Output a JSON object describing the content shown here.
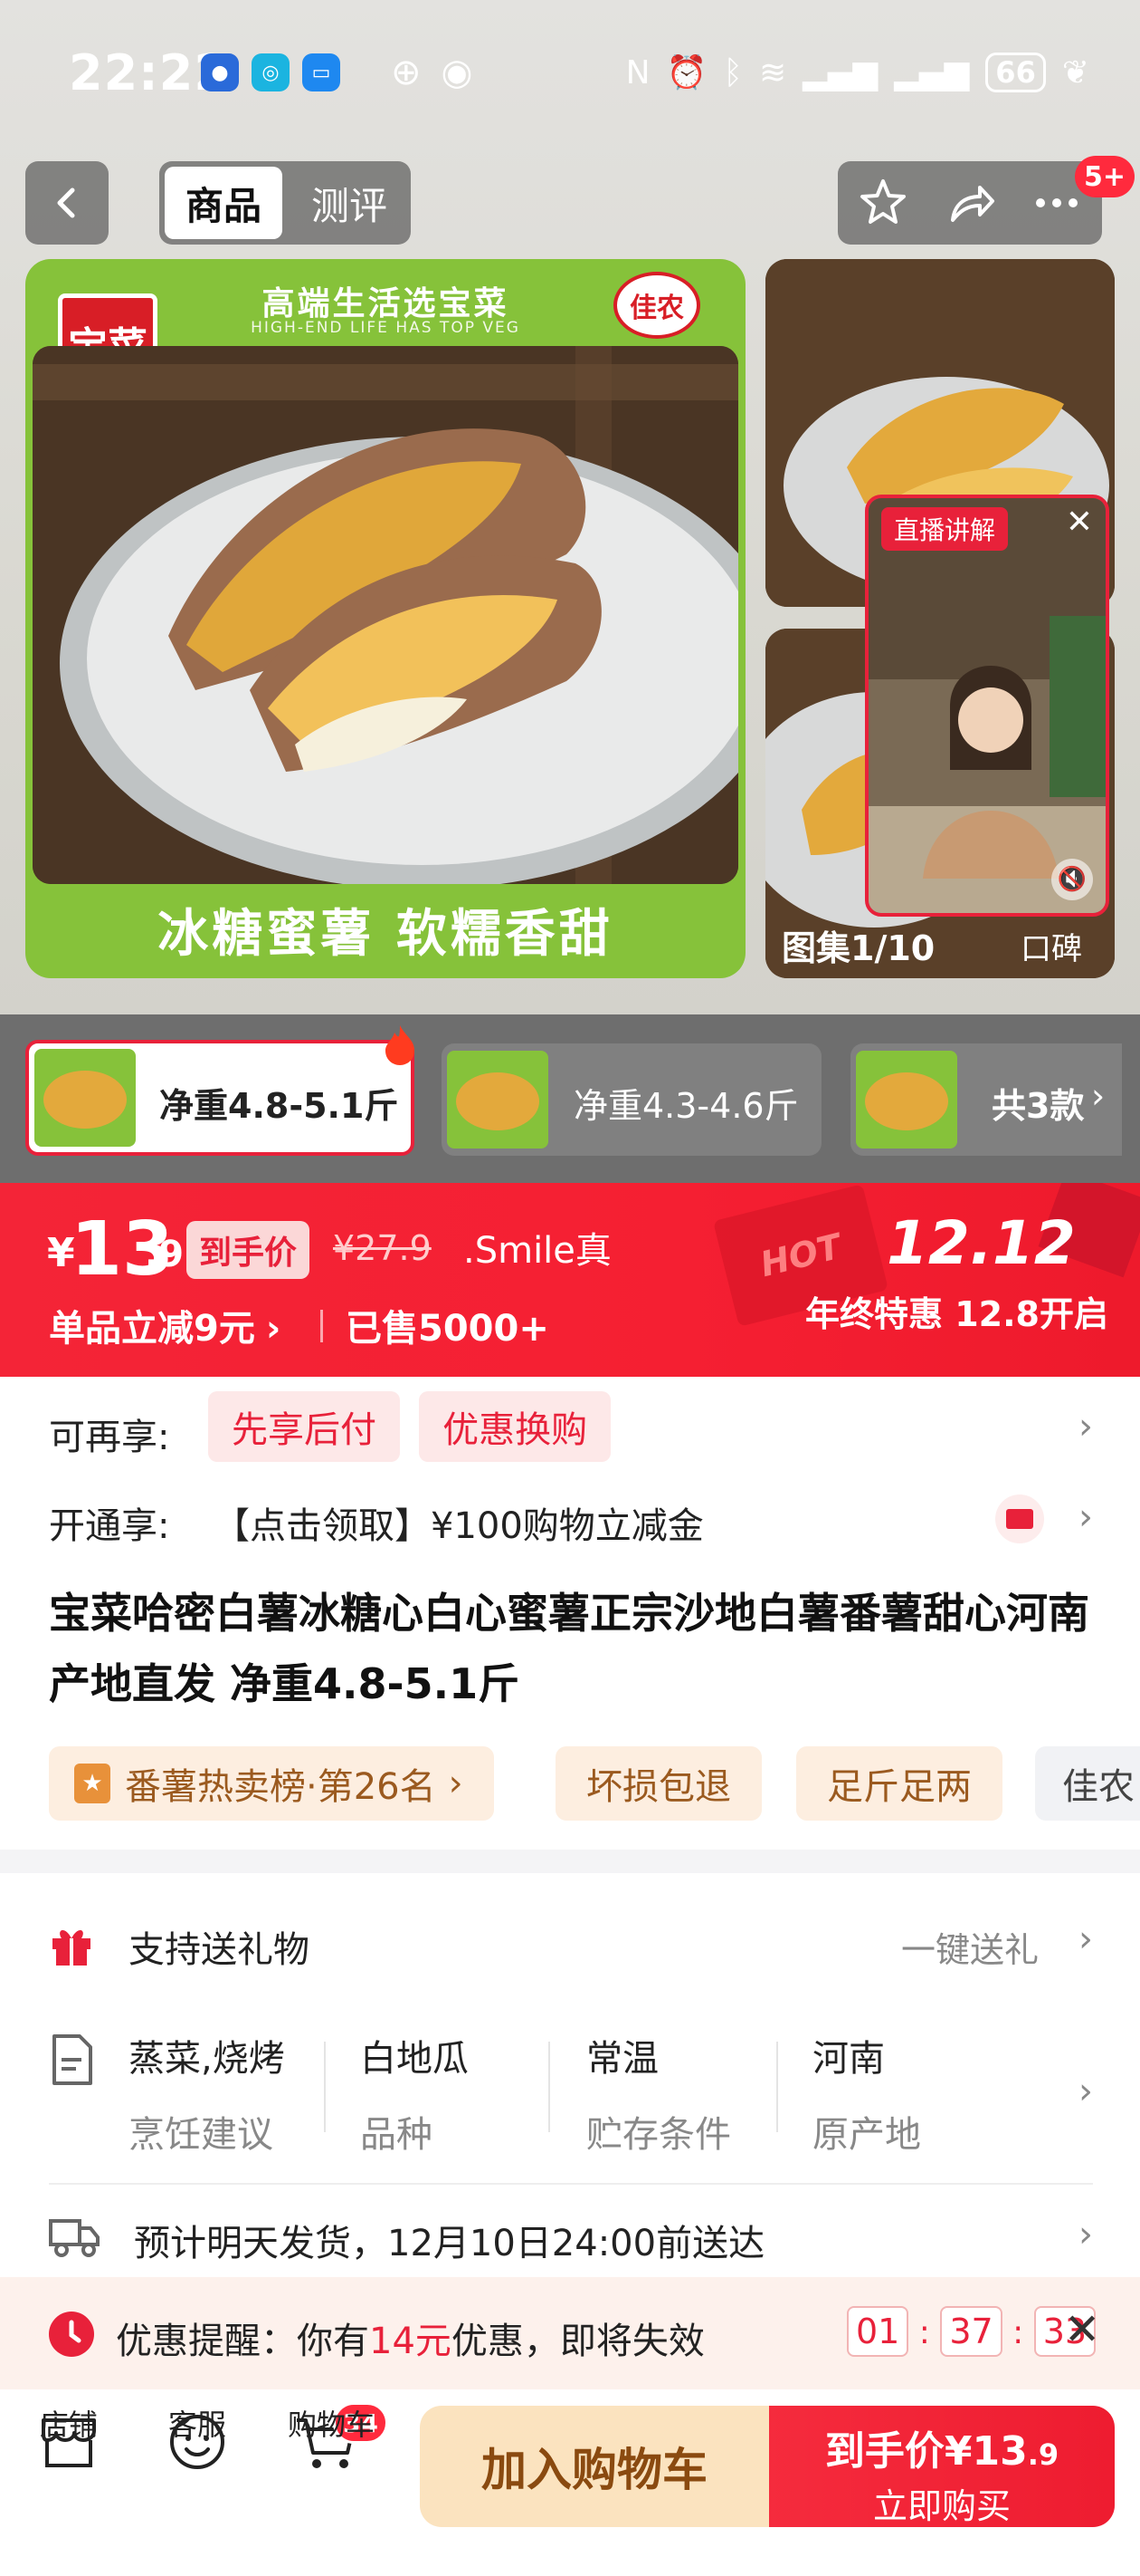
{
  "status_bar": {
    "time": "22:22",
    "battery": "66"
  },
  "nav": {
    "tab_product": "商品",
    "tab_review": "测评",
    "badge": "5+"
  },
  "hero": {
    "brand_logo": "宝菜",
    "slogan": "高端生活选宝菜",
    "slogan_en": "HIGH-END LIFE HAS TOP VEG",
    "partner_logo": "佳农",
    "caption": "冰糖蜜薯  软糯香甜"
  },
  "side_panel": {
    "live_label": "直播讲解",
    "gallery_counter": "图集1/10",
    "reviews_label": "口碑"
  },
  "variants": {
    "items": [
      {
        "label": "净重4.8-5.1斤"
      },
      {
        "label": "净重4.3-4.6斤"
      }
    ],
    "more": "共3款"
  },
  "price": {
    "currency": "¥",
    "integer": "13",
    "decimal": ".9",
    "final_badge": "到手价",
    "original": "¥27.9",
    "brand_note": ".Smile真",
    "discount": "单品立减9元",
    "sold": "已售5000+",
    "promo_date": "12.12",
    "promo_text": "年终特惠 12.8开启",
    "hot": "HOT"
  },
  "benefits": {
    "label1": "可再享:",
    "pill1": "先享后付",
    "pill2": "优惠换购",
    "label2": "开通享:",
    "offer": "【点击领取】¥100购物立减金"
  },
  "product": {
    "title": "宝菜哈密白薯冰糖心白心蜜薯正宗沙地白薯番薯甜心河南产地直发 净重4.8-5.1斤",
    "tags": [
      "番薯热卖榜·第26名",
      "坏损包退",
      "足斤足两",
      "佳农"
    ]
  },
  "gift": {
    "label": "支持送礼物",
    "action": "一键送礼"
  },
  "specs": [
    {
      "value": "蒸菜,烧烤",
      "key": "烹饪建议"
    },
    {
      "value": "白地瓜",
      "key": "品种"
    },
    {
      "value": "常温",
      "key": "贮存条件"
    },
    {
      "value": "河南",
      "key": "原产地"
    }
  ],
  "shipping": {
    "text": "预计明天发货，12月10日24:00前送达"
  },
  "reminder": {
    "prefix": "优惠提醒：你有",
    "amount": "14元",
    "suffix": "优惠，即将失效",
    "hh": "01",
    "mm": "37",
    "ss": "33"
  },
  "tabbar": {
    "store": "店铺",
    "service": "客服",
    "cart": "购物车",
    "cart_count": "34",
    "add_cart": "加入购物车",
    "buy_label": "到手价",
    "buy_price_int": "¥13",
    "buy_price_dec": ".9",
    "buy_sub": "立即购买"
  },
  "colors": {
    "accent": "#e8213a",
    "hero_green": "#86c23a",
    "cart_btn_bg": "#fbe3bf",
    "cart_btn_text": "#8a4a10"
  }
}
